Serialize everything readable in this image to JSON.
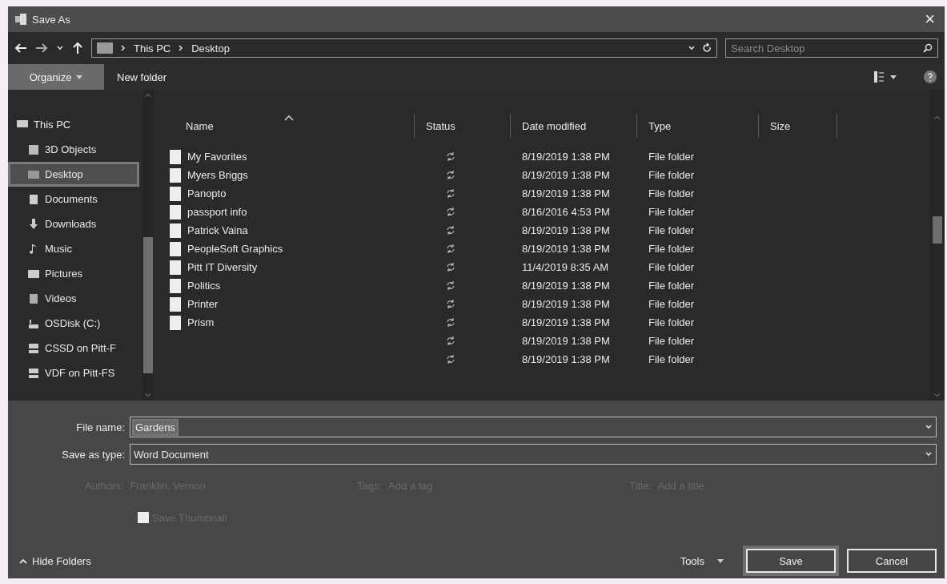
{
  "window": {
    "title": "Save As",
    "close": "×"
  },
  "address": {
    "crumbs": [
      "This PC",
      "Desktop"
    ]
  },
  "search": {
    "placeholder": "Search Desktop"
  },
  "toolbar": {
    "organize": "Organize",
    "new_folder": "New folder"
  },
  "sidebar": {
    "items": [
      {
        "label": "This PC",
        "selected": false,
        "children": [
          {
            "label": "3D Objects",
            "selected": false
          },
          {
            "label": "Desktop",
            "selected": true
          },
          {
            "label": "Documents",
            "selected": false
          },
          {
            "label": "Downloads",
            "selected": false
          },
          {
            "label": "Music",
            "selected": false
          },
          {
            "label": "Pictures",
            "selected": false
          },
          {
            "label": "Videos",
            "selected": false
          },
          {
            "label": "OSDisk (C:)",
            "selected": false
          },
          {
            "label": "CSSD on Pitt-F",
            "selected": false
          },
          {
            "label": "VDF on Pitt-FS",
            "selected": false
          }
        ]
      }
    ]
  },
  "table": {
    "columns": [
      {
        "label": "Name",
        "sorted": true
      },
      {
        "label": "Status",
        "sorted": false
      },
      {
        "label": "Date modified",
        "sorted": false
      },
      {
        "label": "Type",
        "sorted": false
      },
      {
        "label": "Size",
        "sorted": false
      }
    ],
    "rows": [
      {
        "name": "My Favorites",
        "date": "8/19/2019 1:38 PM",
        "type": "File folder"
      },
      {
        "name": "Myers Briggs",
        "date": "8/19/2019 1:38 PM",
        "type": "File folder"
      },
      {
        "name": "Panopto",
        "date": "8/19/2019 1:38 PM",
        "type": "File folder"
      },
      {
        "name": "passport info",
        "date": "8/16/2016 4:53 PM",
        "type": "File folder"
      },
      {
        "name": "Patrick Vaina",
        "date": "8/19/2019 1:38 PM",
        "type": "File folder"
      },
      {
        "name": "PeopleSoft Graphics",
        "date": "8/19/2019 1:38 PM",
        "type": "File folder"
      },
      {
        "name": "Pitt IT Diversity",
        "date": "11/4/2019 8:35 AM",
        "type": "File folder"
      },
      {
        "name": "Politics",
        "date": "8/19/2019 1:38 PM",
        "type": "File folder"
      },
      {
        "name": "Printer",
        "date": "8/19/2019 1:38 PM",
        "type": "File folder"
      },
      {
        "name": "Prism",
        "date": "8/19/2019 1:38 PM",
        "type": "File folder"
      },
      {
        "date": "8/19/2019 1:38 PM",
        "type": "File folder"
      },
      {
        "date": "8/19/2019 1:38 PM",
        "type": "File folder"
      }
    ]
  },
  "form": {
    "file_name": {
      "label": "File name:",
      "value": "Gardens"
    },
    "save_as_type": {
      "label": "Save as type:",
      "value": "Word Document"
    },
    "metadata": [
      {
        "label": "Authors:",
        "value": "Franklin, Vernon",
        "disabled": true
      },
      {
        "label": "Tags:",
        "value": "Add a tag",
        "disabled": true
      },
      {
        "label": "Title:",
        "value": "Add a title",
        "disabled": true
      }
    ],
    "thumbnail": {
      "label": "Save Thumbnail",
      "checked": false,
      "disabled": true
    }
  },
  "footer": {
    "hide_folders": "Hide Folders",
    "tools": "Tools",
    "buttons": [
      {
        "label": "Save",
        "default": true
      },
      {
        "label": "Cancel",
        "default": false
      }
    ]
  }
}
